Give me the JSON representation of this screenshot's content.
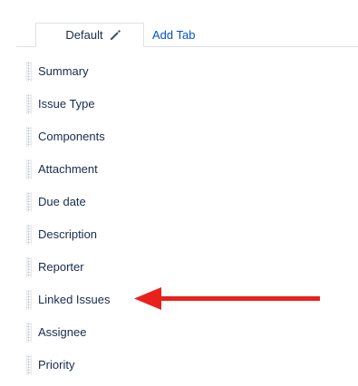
{
  "tabs": {
    "default_label": "Default",
    "add_tab_label": "Add Tab"
  },
  "fields": [
    "Summary",
    "Issue Type",
    "Components",
    "Attachment",
    "Due date",
    "Description",
    "Reporter",
    "Linked Issues",
    "Assignee",
    "Priority"
  ],
  "colors": {
    "link": "#0052cc",
    "text": "#172b4d",
    "annotation_arrow": "#e8221b"
  },
  "icons": {
    "edit": "pencil-icon",
    "drag": "drag-handle-icon",
    "annotation": "red-arrow-icon"
  }
}
